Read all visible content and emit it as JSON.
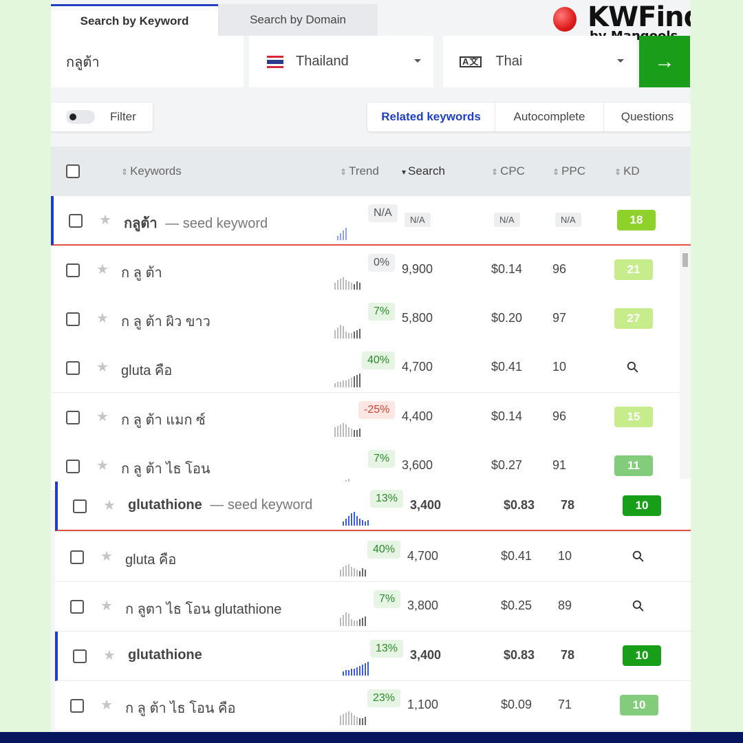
{
  "tabs": [
    {
      "label": "Search by Keyword",
      "active": true
    },
    {
      "label": "Search by Domain",
      "active": false
    }
  ],
  "logo": {
    "brand": "KWFinder",
    "by": "by Mangools"
  },
  "search": {
    "keyword": "กลูต้า",
    "country": "Thailand",
    "language": "Thai",
    "language_icon": "translate-icon"
  },
  "filter": {
    "label": "Filter"
  },
  "modes": [
    "Related keywords",
    "Autocomplete",
    "Questions"
  ],
  "columns": {
    "keywords": "Keywords",
    "trend": "Trend",
    "search": "Search",
    "cpc": "CPC",
    "ppc": "PPC",
    "kd": "KD"
  },
  "seed_label": "— seed keyword",
  "na": "N/A",
  "rows_top": [
    {
      "keyword": "กลูต้า",
      "seed": true,
      "trend": "N/A",
      "trend_type": "neu",
      "search": "N/A",
      "cpc": "N/A",
      "ppc": "N/A",
      "kd": "18",
      "kd_color": "#8fd12b"
    },
    {
      "keyword": "ก ลู ต้า",
      "trend": "0%",
      "trend_type": "neu",
      "search": "9,900",
      "cpc": "$0.14",
      "ppc": "96",
      "kd": "21",
      "kd_color": "#c6ec8c"
    },
    {
      "keyword": "ก ลู ต้า ผิว ขาว",
      "trend": "7%",
      "trend_type": "pos",
      "search": "5,800",
      "cpc": "$0.20",
      "ppc": "97",
      "kd": "27",
      "kd_color": "#c6ec8c"
    },
    {
      "keyword": "gluta คือ",
      "trend": "40%",
      "trend_type": "pos",
      "search": "4,700",
      "cpc": "$0.41",
      "ppc": "10",
      "kd": "",
      "kd_color": ""
    },
    {
      "keyword": "ก ลู ต้า แมก ซ์",
      "trend": "-25%",
      "trend_type": "neg",
      "search": "4,400",
      "cpc": "$0.14",
      "ppc": "96",
      "kd": "15",
      "kd_color": "#c6ec8c"
    },
    {
      "keyword": "ก ลู ต้า ไธ โอน",
      "trend": "7%",
      "trend_type": "pos",
      "search": "3,600",
      "cpc": "$0.27",
      "ppc": "91",
      "kd": "11",
      "kd_color": "#82cc7c"
    }
  ],
  "rows_bottom": [
    {
      "keyword": "glutathione",
      "seed": true,
      "trend": "13%",
      "trend_type": "pos",
      "search": "3,400",
      "cpc": "$0.83",
      "ppc": "78",
      "kd": "10",
      "kd_color": "#189e18",
      "bold": true
    },
    {
      "keyword": "gluta คือ",
      "trend": "40%",
      "trend_type": "pos",
      "search": "4,700",
      "cpc": "$0.41",
      "ppc": "10",
      "kd": "",
      "kd_color": ""
    },
    {
      "keyword": "ก ลูตา ไธ โอน glutathione",
      "trend": "7%",
      "trend_type": "pos",
      "search": "3,800",
      "cpc": "$0.25",
      "ppc": "89",
      "kd": "",
      "kd_color": ""
    },
    {
      "keyword": "glutathione",
      "trend": "13%",
      "trend_type": "pos",
      "search": "3,400",
      "cpc": "$0.83",
      "ppc": "78",
      "kd": "10",
      "kd_color": "#189e18",
      "bold": true,
      "highlight": true
    },
    {
      "keyword": "ก ลู ต้า ไธ โอน คือ",
      "trend": "23%",
      "trend_type": "pos",
      "search": "1,100",
      "cpc": "$0.09",
      "ppc": "71",
      "kd": "10",
      "kd_color": "#82cc7c"
    }
  ],
  "colors": {
    "accent": "#1e3fc4",
    "go": "#1a9e1a",
    "seed_border": "#e0503c",
    "bottom_bar": "#06155e",
    "background": "#e3f7dc"
  }
}
